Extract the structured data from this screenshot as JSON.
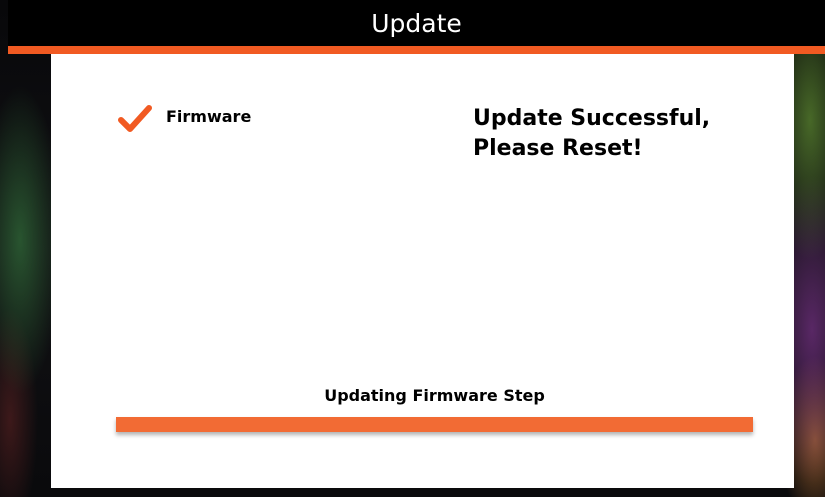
{
  "header": {
    "title": "Update"
  },
  "steps": [
    {
      "label": "Firmware",
      "status_icon": "check-icon"
    }
  ],
  "status": {
    "line1": "Update Successful,",
    "line2": "Please Reset!"
  },
  "progress": {
    "label": "Updating Firmware Step",
    "percent": 100
  },
  "colors": {
    "accent": "#f15a22",
    "progress": "#f26b34",
    "title_bar": "#000000",
    "panel": "#ffffff"
  }
}
